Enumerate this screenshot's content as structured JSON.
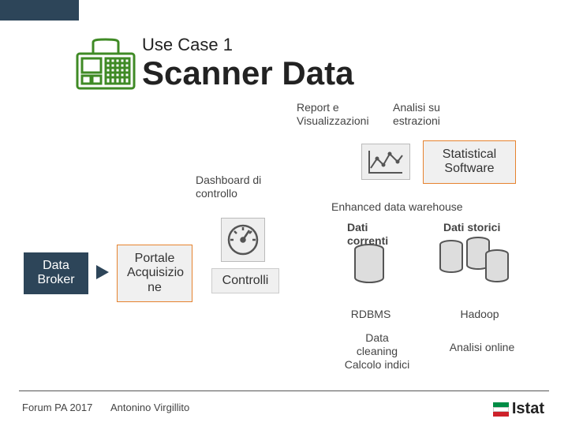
{
  "header": {
    "usecase": "Use Case 1",
    "title": "Scanner Data"
  },
  "labels": {
    "report": "Report e\nVisualizzazioni",
    "analisi_estr": "Analisi su\nestrazioni",
    "dashboard": "Dashboard di\ncontrollo",
    "enhanced": "Enhanced data warehouse",
    "dati_correnti": "Dati\ncorrenti",
    "dati_storici": "Dati storici",
    "controlli": "Controlli",
    "rdbms": "RDBMS",
    "hadoop": "Hadoop",
    "cleaning": "Data\ncleaning\nCalcolo indici",
    "analisi_online": "Analisi online"
  },
  "boxes": {
    "data_broker": "Data\nBroker",
    "portale": "Portale\nAcquisizio\nne",
    "statsoft": "Statistical\nSoftware"
  },
  "footer": {
    "event": "Forum PA 2017",
    "author": "Antonino Virgillito",
    "logo": "Istat"
  },
  "icons": {
    "scanner": "scanner-icon",
    "chart": "line-chart-icon",
    "gauge": "gauge-icon",
    "database": "database-icon"
  },
  "colors": {
    "dark": "#2d4559",
    "green": "#3f8a25",
    "orange": "#e6832f",
    "red": "#b52f2f",
    "flag_green": "#008c45",
    "flag_red": "#cd212a"
  }
}
